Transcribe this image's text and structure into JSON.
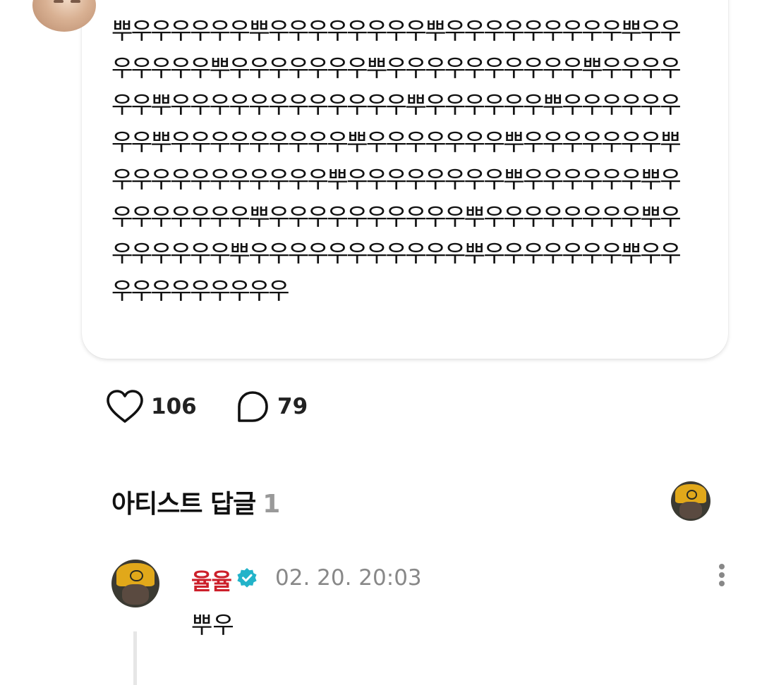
{
  "post": {
    "text": "뿌우우우우우우뿌우우우우우우우우뿌우우우우우우우우우뿌우우우우우우우뿌우우우우우우우뿌우우우우우우우우우우뿌우우우우우우뿌우우우우우우우우우우우우뿌우우우우우우뿌우우우우우우우우뿌우우우우우우우우우뿌우우우우우우우뿌우우우우우우우뿌우우우우우우우우우우우뿌우우우우우우우우뿌우우우우우우뿌우우우우우우우우뿌우우우우우우우우우우뿌우우우우우우우우뿌우우우우우우우뿌우우우우우우우우우우우뿌우우우우우우우뿌우우우우우우우우우우우"
  },
  "actions": {
    "likes": "106",
    "comments": "79",
    "like_icon": "heart-outline-icon",
    "comment_icon": "speech-bubble-icon"
  },
  "section": {
    "title": "아티스트 답글",
    "count": "1"
  },
  "comment": {
    "author": "율율",
    "author_color": "#cc1f2a",
    "verified_icon": "verified-badge-icon",
    "verified_color": "#22b3c9",
    "time": "02. 20. 20:03",
    "body": "뿌우",
    "more_icon": "more-vertical-icon"
  }
}
